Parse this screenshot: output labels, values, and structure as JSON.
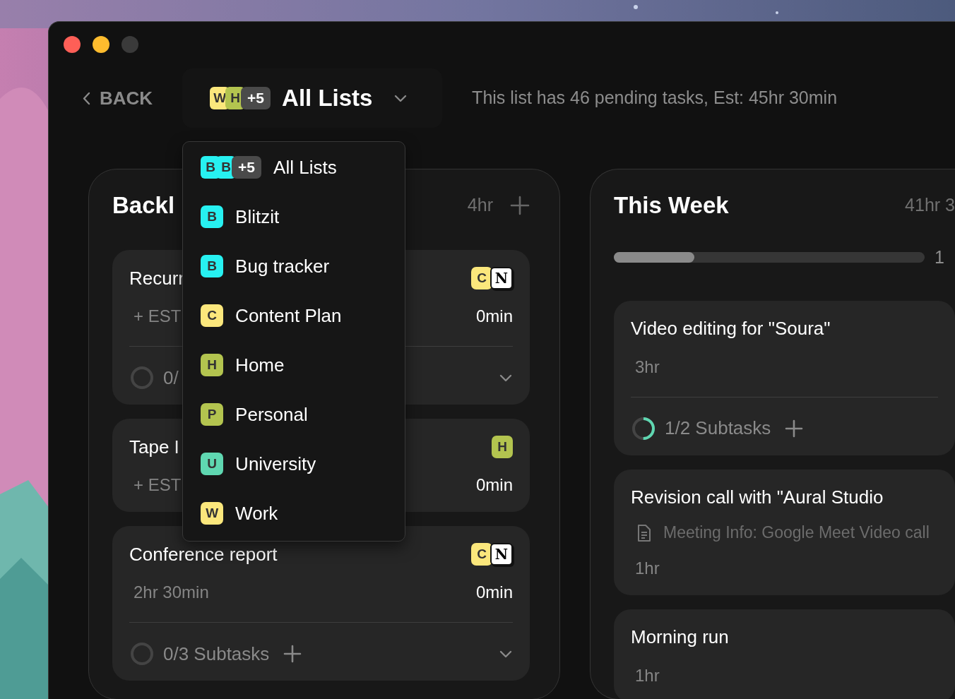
{
  "header": {
    "back": "BACK",
    "list_selector": {
      "badges": [
        {
          "letter": "W",
          "color": "#fbe77c"
        },
        {
          "letter": "H",
          "color": "#b3c44f"
        }
      ],
      "more": "+5",
      "label": "All Lists",
      "expanded": true
    },
    "summary": "This list has 46 pending tasks, Est: 45hr 30min"
  },
  "dropdown": {
    "items": [
      {
        "badges": [
          {
            "letter": "B",
            "color": "#27f1f1"
          },
          {
            "letter": "B",
            "color": "#27f1f1"
          }
        ],
        "more": "+5",
        "label": "All Lists"
      },
      {
        "badges": [
          {
            "letter": "B",
            "color": "#27f1f1"
          }
        ],
        "label": "Blitzit"
      },
      {
        "badges": [
          {
            "letter": "B",
            "color": "#27f1f1"
          }
        ],
        "label": "Bug tracker"
      },
      {
        "badges": [
          {
            "letter": "C",
            "color": "#fbe77c"
          }
        ],
        "label": "Content Plan"
      },
      {
        "badges": [
          {
            "letter": "H",
            "color": "#b3c44f"
          }
        ],
        "label": "Home"
      },
      {
        "badges": [
          {
            "letter": "P",
            "color": "#b3c44f"
          }
        ],
        "label": "Personal"
      },
      {
        "badges": [
          {
            "letter": "U",
            "color": "#5fd7b1"
          }
        ],
        "label": "University"
      },
      {
        "badges": [
          {
            "letter": "W",
            "color": "#fbe77c"
          }
        ],
        "label": "Work"
      }
    ]
  },
  "columns": [
    {
      "title": "Backl",
      "total": "4hr",
      "add": true,
      "cards": [
        {
          "title": "Recurr",
          "tags": [
            {
              "kind": "letter",
              "letter": "C",
              "color": "#fbe77c"
            },
            {
              "kind": "app",
              "letter": "N"
            }
          ],
          "estimate": "+ EST",
          "spent": "0min",
          "subtasks": {
            "text": "0/",
            "kind": "empty",
            "add": false,
            "collapsible": true
          }
        },
        {
          "title": "Tape I",
          "tags": [
            {
              "kind": "letter",
              "letter": "H",
              "color": "#b3c44f"
            }
          ],
          "estimate": "+ EST",
          "spent": "0min"
        },
        {
          "title": "Conference report",
          "tags": [
            {
              "kind": "letter",
              "letter": "C",
              "color": "#fbe77c"
            },
            {
              "kind": "app",
              "letter": "N"
            }
          ],
          "estimate": "2hr 30min",
          "spent": "0min",
          "subtasks": {
            "text": "0/3 Subtasks",
            "kind": "empty",
            "add": true,
            "collapsible": true
          }
        }
      ]
    },
    {
      "title": "This Week",
      "total": "41hr 3",
      "add": false,
      "progress": {
        "level": 0.26,
        "reading": "1"
      },
      "cards": [
        {
          "title": "Video editing for \"Soura\"",
          "estimate": "3hr",
          "subtasks": {
            "text": "1/2 Subtasks",
            "kind": "half",
            "add": true,
            "collapsible": false
          }
        },
        {
          "title": "Revision call with \"Aural Studio",
          "note": "Meeting Info: Google Meet Video call",
          "estimate": "1hr"
        },
        {
          "title": "Morning run",
          "estimate": "1hr"
        }
      ]
    }
  ]
}
